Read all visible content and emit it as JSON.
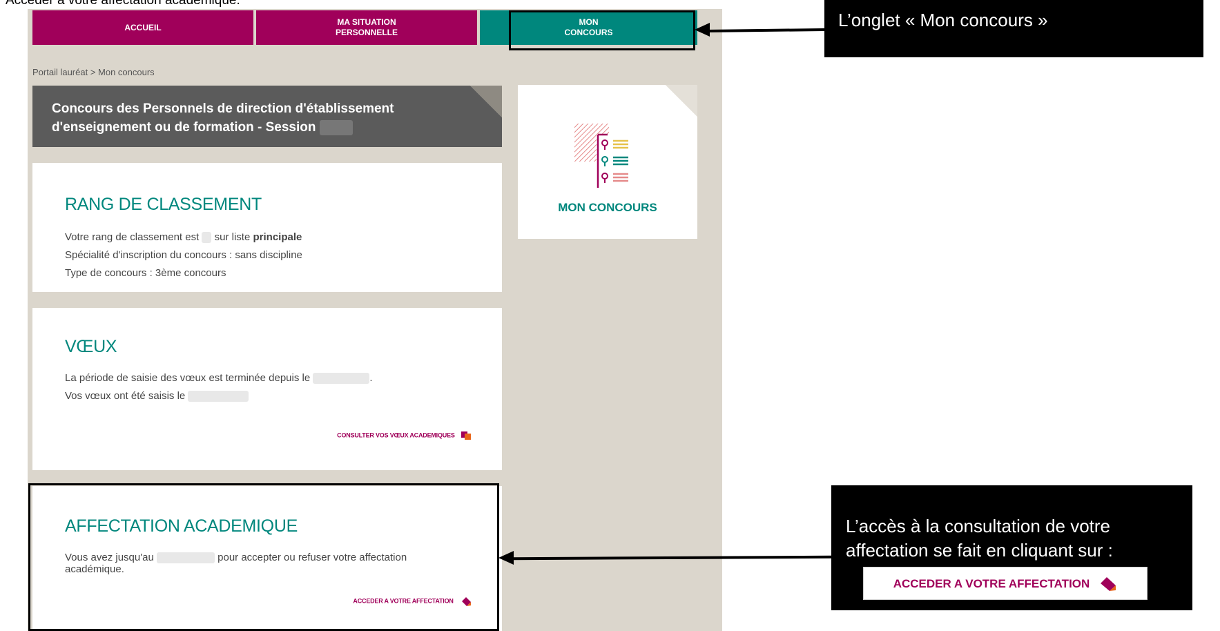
{
  "doc_title": "Accéder à votre affectation académique.",
  "nav": {
    "tabs": [
      {
        "label": "ACCUEIL"
      },
      {
        "label": "MA SITUATION PERSONNELLE"
      },
      {
        "label": "MON CONCOURS"
      }
    ]
  },
  "breadcrumb": "Portail lauréat > Mon concours",
  "banner": {
    "line1": "Concours des Personnels de direction d'établissement",
    "line2": "d'enseignement ou de formation - Session"
  },
  "rang": {
    "title": "RANG DE CLASSEMENT",
    "line1_pre": "Votre rang de classement est",
    "line1_mid": "sur liste",
    "line1_bold": "principale",
    "line2": "Spécialité d'inscription du concours : sans discipline",
    "line3": "Type de concours : 3ème concours"
  },
  "voeux": {
    "title": "VŒUX",
    "line1_pre": "La période de saisie des vœux est terminée depuis le",
    "line1_post": ".",
    "line2_pre": "Vos vœux ont été saisis le",
    "link": "CONSULTER VOS VŒUX ACADEMIQUES"
  },
  "affectation": {
    "title": "AFFECTATION ACADEMIQUE",
    "line1_pre": "Vous avez jusqu'au",
    "line1_post": "pour accepter ou refuser votre affectation",
    "line2": "académique.",
    "link": "ACCEDER A VOTRE AFFECTATION"
  },
  "side_card": {
    "label": "MON CONCOURS",
    "icon": "contest-list-icon"
  },
  "callouts": {
    "tab_callout": "L’onglet « Mon concours »",
    "access_line1": "L’accès à la consultation de votre",
    "access_line2": "affectation se fait en cliquant sur :",
    "button_label": "ACCEDER A VOTRE AFFECTATION"
  },
  "colors": {
    "magenta": "#a0005a",
    "teal": "#00877d",
    "banner": "#5b5b5b",
    "shell": "#dbd6cc"
  }
}
